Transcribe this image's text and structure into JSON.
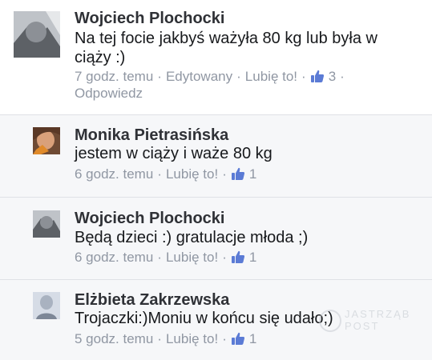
{
  "comments": [
    {
      "author": "Wojciech Plochocki",
      "text_line1": "Na tej focie jakbyś ważyła 80 kg lub była w",
      "text_line2": "ciąży :)",
      "time": "7 godz. temu",
      "edited": "Edytowany",
      "like": "Lubię to!",
      "like_count": "3",
      "reply": "Odpowiedz"
    },
    {
      "author": "Monika Pietrasińska",
      "text": "jestem w ciąży i waże 80 kg",
      "time": "6 godz. temu",
      "like": "Lubię to!",
      "like_count": "1"
    },
    {
      "author": "Wojciech Plochocki",
      "text": "Będą dzieci :) gratulacje młoda ;)",
      "time": "6 godz. temu",
      "like": "Lubię to!",
      "like_count": "1"
    },
    {
      "author": "Elżbieta Zakrzewska",
      "text": "Trojaczki:)Moniu w końcu się udało;)",
      "time": "5 godz. temu",
      "like": "Lubię to!",
      "like_count": "1"
    }
  ],
  "separator": "·",
  "icons": {
    "like": "thumbs-up-icon"
  },
  "watermark": {
    "line1": "JASTRZĄB",
    "line2": "POST"
  },
  "colors": {
    "meta_text": "#9097a3",
    "like_icon": "#5b7bd5",
    "name_text": "#2f3136"
  }
}
